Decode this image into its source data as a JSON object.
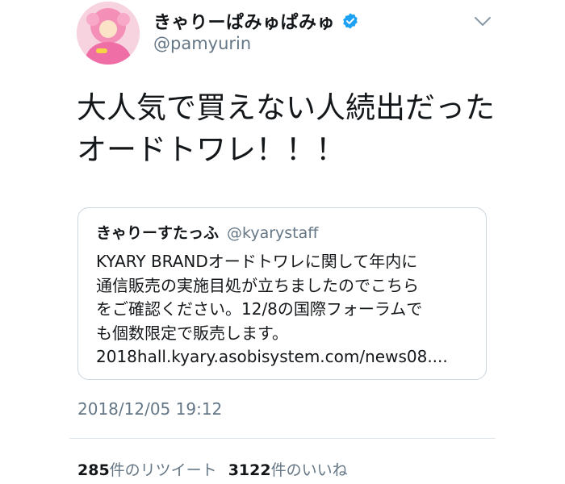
{
  "colors": {
    "text_primary": "#14171a",
    "text_secondary": "#657786",
    "verified_blue": "#1da1f2",
    "border": "#ccd6dd",
    "avatar_pink": "#f48fb8"
  },
  "author": {
    "display_name": "きゃりーぱみゅぱみゅ",
    "handle": "@pamyurin",
    "verified_icon": "verified-badge-icon",
    "menu_icon": "chevron-down-icon"
  },
  "tweet": {
    "text": "大人気で買えない人続出だったオードトワレ！！！"
  },
  "quoted_tweet": {
    "display_name": "きゃりーすたっふ",
    "handle": "@kyarystaff",
    "text": "KYARY BRANDオードトワレに関して年内に\n通信販売の実施目処が立ちましたのでこちら\nをご確認ください。12/8の国際フォーラムで\nも個数限定で販売します。\n2018hall.kyary.asobisystem.com/news08...."
  },
  "timestamp": "2018/12/05 19:12",
  "stats": {
    "retweets_count": "285",
    "retweets_label": "件のリツイート",
    "likes_count": "3122",
    "likes_label": "件のいいね"
  }
}
